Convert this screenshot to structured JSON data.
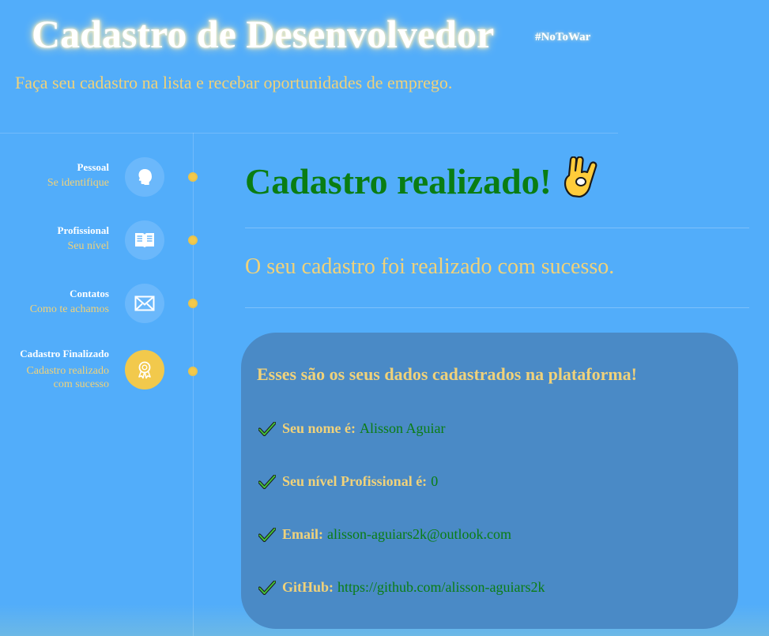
{
  "header": {
    "title": "Cadastro de Desenvolvedor",
    "hashtag": "#NoToWar",
    "subtitle": "Faça seu cadastro na lista e recebar oportunidades de emprego."
  },
  "steps": [
    {
      "title": "Pessoal",
      "subtitle": "Se identifique",
      "icon": "head-icon",
      "state": "done"
    },
    {
      "title": "Profissional",
      "subtitle": "Seu nível",
      "icon": "book-icon",
      "state": "done"
    },
    {
      "title": "Contatos",
      "subtitle": "Como te achamos",
      "icon": "mail-icon",
      "state": "done"
    },
    {
      "title": "Cadastro Finalizado",
      "subtitle_line1": "Cadastro realizado",
      "subtitle_line2": "com sucesso",
      "icon": "award-icon",
      "state": "active"
    }
  ],
  "main": {
    "title": "Cadastro realizado!",
    "emoji": "ok-hand-icon",
    "message": "O seu cadastro foi realizado com sucesso."
  },
  "summary": {
    "title": "Esses são os seus dados cadastrados na plataforma!",
    "items": [
      {
        "label": "Seu nome é:",
        "value": "Alisson Aguiar"
      },
      {
        "label": "Seu nível Profissional é:",
        "value": "0"
      },
      {
        "label": "Email:",
        "value": "alisson-aguiars2k@outlook.com"
      },
      {
        "label": "GitHub:",
        "value": "https://github.com/alisson-aguiars2k"
      }
    ]
  },
  "colors": {
    "background": "#52adfa",
    "accent_yellow": "#f2c94c",
    "text_yellow": "#f0d27a",
    "success_green": "#0a7d13",
    "card": "#4a8ac6"
  }
}
